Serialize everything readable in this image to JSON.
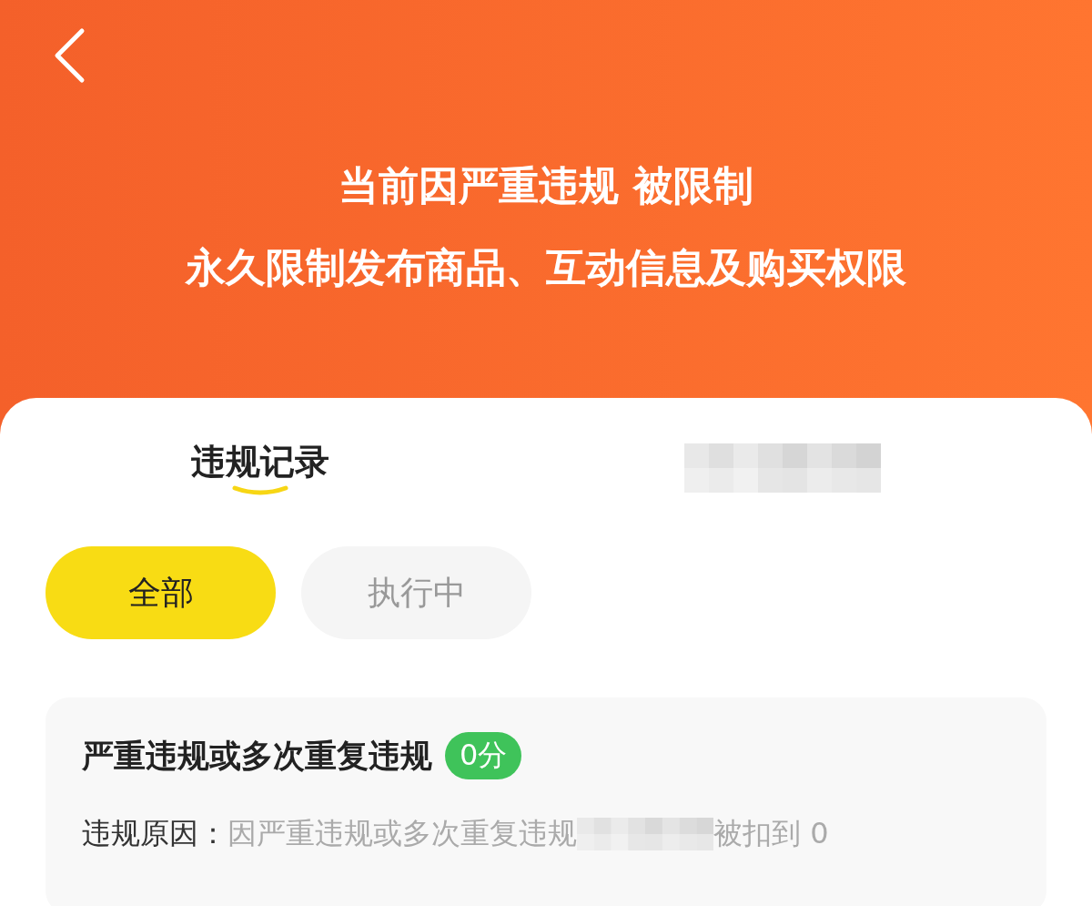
{
  "header": {
    "title_lines": [
      "当前因严重违规 被限制",
      "永久限制发布商品、互动信息及购买权限"
    ]
  },
  "tabs": [
    {
      "kind": "text",
      "label": "违规记录",
      "selected": true
    },
    {
      "kind": "redacted",
      "selected": false
    }
  ],
  "filters": [
    {
      "label": "全部",
      "selected": true
    },
    {
      "label": "执行中",
      "selected": false
    }
  ],
  "record": {
    "title": "严重违规或多次重复违规",
    "score_badge": "0分",
    "reason_label": "违规原因：",
    "reason": [
      {
        "kind": "text",
        "text": "因严重违规或多次重复违规"
      },
      {
        "kind": "redacted"
      },
      {
        "kind": "text",
        "text": "被扣到 0"
      }
    ]
  }
}
